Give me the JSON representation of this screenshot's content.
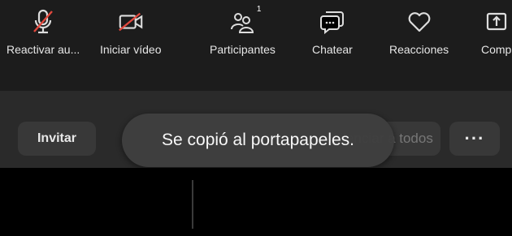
{
  "header": {
    "invite_label": "Invitar",
    "mute_all_label": "Silenciar a todos",
    "more_label": "···"
  },
  "toast": {
    "message": "Se copió al portapapeles."
  },
  "toolbar": {
    "items": [
      {
        "label": "Reactivar au...",
        "icon": "microphone-off-icon"
      },
      {
        "label": "Iniciar vídeo",
        "icon": "video-off-icon"
      },
      {
        "label": "Participantes",
        "icon": "participants-icon",
        "badge": "1"
      },
      {
        "label": "Chatear",
        "icon": "chat-icon"
      },
      {
        "label": "Reacciones",
        "icon": "heart-icon"
      },
      {
        "label": "Comp",
        "icon": "share-icon"
      }
    ]
  },
  "colors": {
    "strike": "#e2483d",
    "toast_bg": "#3f3f3f",
    "pill_bg": "#383838"
  }
}
